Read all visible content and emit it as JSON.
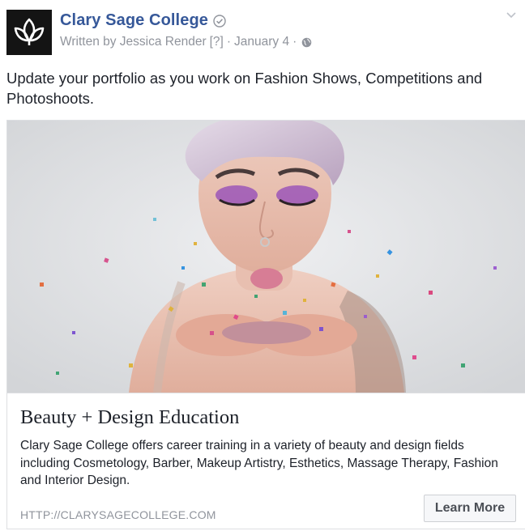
{
  "post": {
    "page_name": "Clary Sage College",
    "written_by": "Written by Jessica Render",
    "help_marker": "[?]",
    "separator": "·",
    "date": "January 4",
    "message": "Update your portfolio as you work on Fashion Shows, Competitions and Photoshoots.",
    "icons": {
      "avatar": "leaf-logo-icon",
      "verified": "verified-check-icon",
      "privacy": "globe-icon",
      "menu": "chevron-down-icon"
    }
  },
  "link_card": {
    "title": "Beauty + Design Education",
    "description": "Clary Sage College offers career training in a variety of beauty and design fields including Cosmetology, Barber, Makeup Artistry, Esthetics, Massage Therapy, Fashion and Interior Design.",
    "url": "HTTP://CLARYSAGECOLLEGE.COM",
    "cta_label": "Learn More"
  },
  "colors": {
    "page_name": "#365899",
    "meta": "#90949c",
    "text": "#1d2129",
    "border": "#dddfe2",
    "button_bg": "#f6f7f9"
  }
}
